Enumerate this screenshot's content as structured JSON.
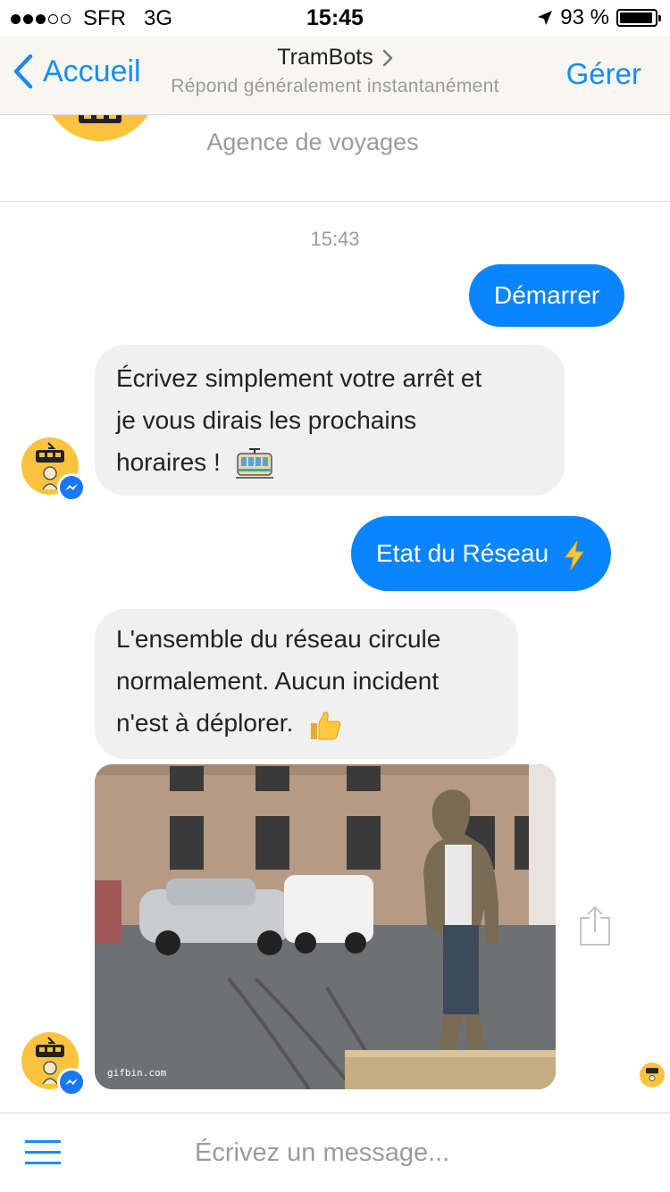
{
  "status_bar": {
    "carrier": "SFR",
    "network": "3G",
    "time": "15:45",
    "battery": "93 %"
  },
  "nav": {
    "back_label": "Accueil",
    "title": "TramBots",
    "subtitle": "Répond généralement instantanément",
    "manage_label": "Gérer"
  },
  "profile": {
    "category": "Agence de voyages"
  },
  "conversation": {
    "timestamp": "15:43",
    "messages": [
      {
        "from": "user",
        "text": "Démarrer"
      },
      {
        "from": "bot",
        "lines": [
          "Écrivez simplement votre arrêt et",
          "je vous dirais les prochains",
          "horaires !"
        ],
        "emoji": "tram-icon"
      },
      {
        "from": "user",
        "text": "Etat du Réseau",
        "emoji": "lightning-icon"
      },
      {
        "from": "bot",
        "lines": [
          "L'ensemble du réseau circule",
          "normalement. Aucun incident",
          "n'est à déplorer."
        ],
        "emoji": "thumbs-up-icon"
      },
      {
        "from": "bot",
        "type": "gif",
        "credit": "gifbin.com"
      }
    ]
  },
  "composer": {
    "placeholder": "Écrivez un message..."
  },
  "colors": {
    "accent": "#0a84ff",
    "link": "#1a8cf0",
    "bot_bubble": "#f1f0f0",
    "avatar_bg": "#f9c33e"
  }
}
